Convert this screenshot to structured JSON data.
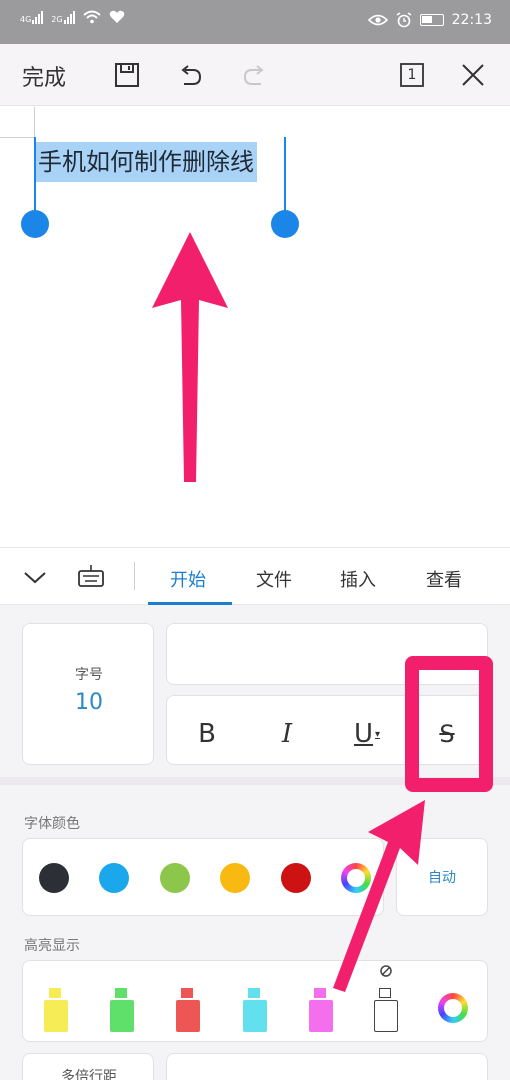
{
  "status_bar": {
    "network_1": "4G",
    "network_2": "2G",
    "time": "22:13"
  },
  "toolbar": {
    "done_label": "完成",
    "icons": [
      "save-icon",
      "undo-icon",
      "redo-icon",
      "page-count-icon",
      "close-icon"
    ],
    "page_count": "1"
  },
  "document": {
    "selected_text": "手机如何制作删除线"
  },
  "ribbon": {
    "tabs": [
      {
        "label": "开始",
        "active": true
      },
      {
        "label": "文件",
        "active": false
      },
      {
        "label": "插入",
        "active": false
      },
      {
        "label": "查看",
        "active": false
      }
    ]
  },
  "panel": {
    "font_size_label": "字号",
    "font_size_value": "10",
    "format_buttons": [
      {
        "name": "bold",
        "glyph": "B"
      },
      {
        "name": "italic",
        "glyph": "I"
      },
      {
        "name": "underline",
        "glyph": "U"
      },
      {
        "name": "strikethrough",
        "glyph": "S"
      }
    ],
    "font_color_label": "字体颜色",
    "font_colors": [
      "#2c2f36",
      "#1aa7ec",
      "#8cc64a",
      "#f8b912",
      "#cc1212"
    ],
    "auto_label": "自动",
    "highlight_label": "高亮显示",
    "highlight_colors": [
      "#f6ec55",
      "#5ee06a",
      "#ee5555",
      "#63e0ee",
      "#f36fee"
    ],
    "line_spacing_label": "多倍行距"
  },
  "annotation": {
    "accent_color": "#f21f6d"
  }
}
